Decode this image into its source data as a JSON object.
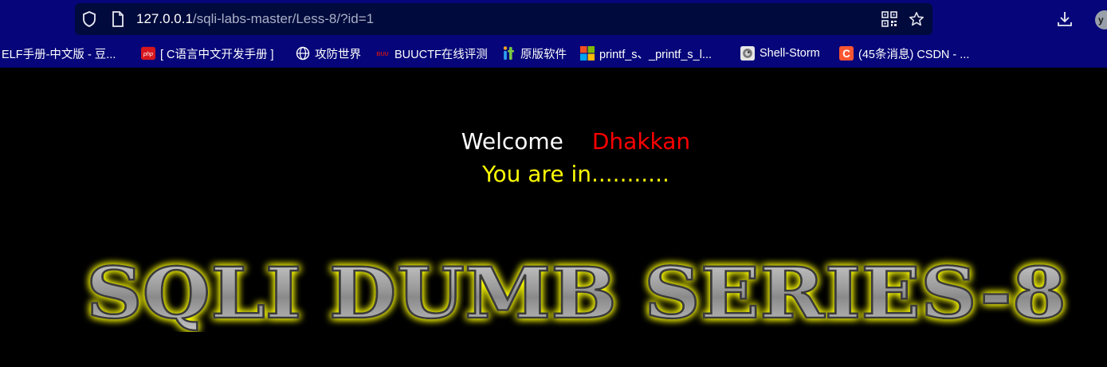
{
  "browser": {
    "url_host": "127.0.0.1",
    "url_path": "/sqli-labs-master/Less-8/?id=1",
    "avatar_letter": "y"
  },
  "bookmarks": [
    {
      "label": "ELF手册-中文版 - 豆...",
      "icon": "none"
    },
    {
      "label": "[ C语言中文开发手册 ]",
      "icon": "php-icon"
    },
    {
      "label": "攻防世界",
      "icon": "globe-icon"
    },
    {
      "label": "BUUCTF在线评测",
      "icon": "buuctf-icon"
    },
    {
      "label": "原版软件",
      "icon": "original-software-icon"
    },
    {
      "label": "printf_s、_printf_s_l...",
      "icon": "microsoft-icon"
    },
    {
      "label": "Shell-Storm",
      "icon": "shell-storm-icon"
    },
    {
      "label": "(45条消息) CSDN - ...",
      "icon": "csdn-icon"
    }
  ],
  "page": {
    "welcome": "Welcome",
    "name": "Dhakkan",
    "status": "You are in...........",
    "logo_text": "SQLI DUMB SERIES-8"
  },
  "colors": {
    "chrome_bg": "#06067a",
    "page_bg": "#000000",
    "welcome": "#ffffff",
    "name": "#ff0000",
    "status": "#ffff00",
    "logo_glow": "#ffff00"
  }
}
